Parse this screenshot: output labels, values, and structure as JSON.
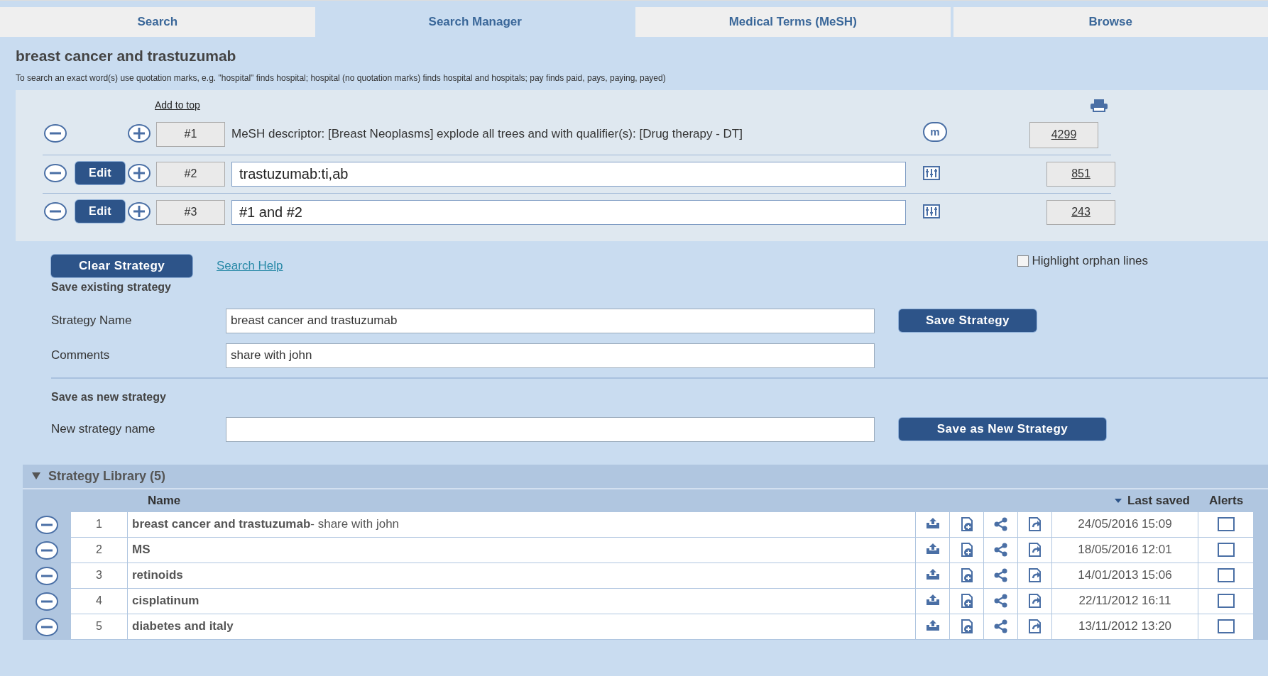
{
  "tabs": [
    {
      "label": "Search",
      "selected": false
    },
    {
      "label": "Search Manager",
      "selected": true
    },
    {
      "label": "Medical Terms (MeSH)",
      "selected": false
    },
    {
      "label": "Browse",
      "selected": false
    }
  ],
  "query": {
    "title": "breast cancer and trastuzumab",
    "hint": "To search an exact word(s) use quotation marks, e.g. \"hospital\" finds hospital; hospital (no quotation marks) finds hospital and hospitals; pay finds paid, pays, paying, payed)"
  },
  "search_lines": {
    "add_to_top": "Add to top",
    "lines": [
      {
        "kind": "mesh",
        "number": "#1",
        "text": "MeSH descriptor: [Breast Neoplasms] explode all trees and with qualifier(s): [Drug therapy - DT]",
        "badge": "m",
        "count": "4299"
      },
      {
        "kind": "text",
        "number": "#2",
        "text": "trastuzumab:ti,ab",
        "edit": "Edit",
        "count": "851"
      },
      {
        "kind": "text",
        "number": "#3",
        "text": "#1 and #2",
        "edit": "Edit",
        "count": "243"
      }
    ]
  },
  "actions": {
    "clear_button": "Clear Strategy",
    "help_link": "Search Help",
    "highlight_orphan": {
      "label": "Highlight orphan lines",
      "checked": false
    }
  },
  "save_existing": {
    "heading": "Save existing strategy",
    "fields": [
      {
        "label": "Strategy Name",
        "value": "breast cancer and trastuzumab"
      },
      {
        "label": "Comments",
        "value": "share with john"
      }
    ],
    "button": "Save Strategy"
  },
  "save_new": {
    "heading": "Save as new strategy",
    "field": {
      "label": "New strategy name"
    },
    "button": "Save as New Strategy"
  },
  "library": {
    "title": "Strategy Library (5)",
    "expanded": true,
    "columns": {
      "name": "Name",
      "last_saved": "Last saved",
      "alerts": "Alerts"
    },
    "rows": [
      {
        "number": "1",
        "name": "breast cancer and trastuzumab",
        "comment": " - share with john",
        "last_saved": "24/05/2016 15:09",
        "alert": false
      },
      {
        "number": "2",
        "name": "MS",
        "last_saved": "18/05/2016 12:01",
        "alert": false
      },
      {
        "number": "3",
        "name": "retinoids",
        "last_saved": "14/01/2013 15:06",
        "alert": false
      },
      {
        "number": "4",
        "name": "cisplatinum",
        "last_saved": "22/11/2012 16:11",
        "alert": false
      },
      {
        "number": "5",
        "name": "diabetes and italy",
        "last_saved": "13/11/2012 13:20",
        "alert": false
      }
    ]
  }
}
